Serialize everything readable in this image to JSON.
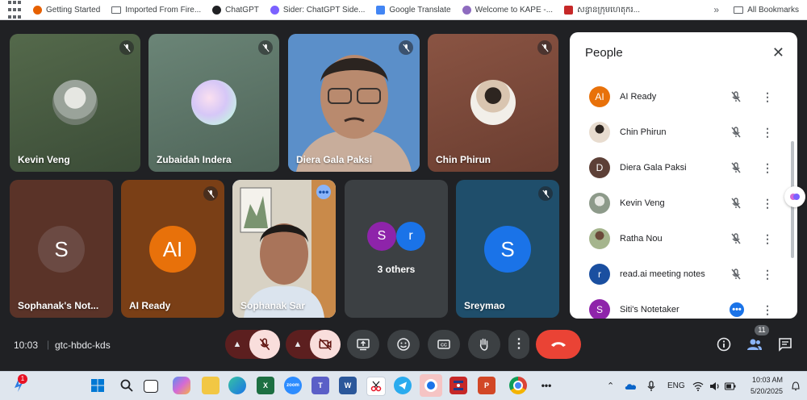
{
  "bookmarks": {
    "items": [
      {
        "label": "Getting Started",
        "icon": "firefox-icon",
        "color": "#e66000"
      },
      {
        "label": "Imported From Fire...",
        "icon": "folder-icon"
      },
      {
        "label": "ChatGPT",
        "icon": "chatgpt-icon",
        "color": "#202124"
      },
      {
        "label": "Sider: ChatGPT Side...",
        "icon": "sider-icon",
        "color": "#7b61ff"
      },
      {
        "label": "Google Translate",
        "icon": "translate-icon",
        "color": "#4285f4"
      },
      {
        "label": "Welcome to KAPE -...",
        "icon": "kape-icon",
        "color": "#8e6bbf"
      },
      {
        "label": "សន្ធានក្រុមហេតុករ...",
        "icon": "khmer-site-icon",
        "color": "#c62828"
      }
    ],
    "all_bookmarks": "All Bookmarks"
  },
  "tiles": [
    {
      "name": "Kevin Veng",
      "bg": "#4b6043",
      "muted": true
    },
    {
      "name": "Zubaidah Indera",
      "bg": "#5c7366",
      "muted": true
    },
    {
      "name": "Diera Gala Paksi",
      "bg": "#5b8fc9",
      "muted": true
    },
    {
      "name": "Chin Phirun",
      "bg": "#7a4a3a",
      "muted": true
    },
    {
      "name": "Sophanak's Not...",
      "bg": "#5a3328",
      "initial": "S",
      "avatar_color": "#6b4a43",
      "muted": false
    },
    {
      "name": "AI Ready",
      "bg": "#7a3f16",
      "initial": "AI",
      "avatar_color": "#e8710a",
      "muted": true
    },
    {
      "name": "Sophanak Sar",
      "bg": "#b9b2a0",
      "muted": false,
      "more": "•••"
    },
    {
      "name": "3 others",
      "bg": "#3c4043",
      "avatars": [
        {
          "initial": "S",
          "color": "#8e24aa"
        },
        {
          "initial": "r",
          "color": "#1a73e8"
        }
      ]
    },
    {
      "name": "Sreymao",
      "bg": "#1f4e6b",
      "initial": "S",
      "avatar_color": "#1a73e8",
      "muted": true
    }
  ],
  "panel": {
    "title": "People",
    "people": [
      {
        "name": "AI Ready",
        "initial": "AI",
        "color": "#e8710a",
        "muted": true
      },
      {
        "name": "Chin Phirun",
        "photo": true,
        "color": "#c9b8a6",
        "muted": true
      },
      {
        "name": "Diera Gala Paksi",
        "initial": "D",
        "color": "#5d4037",
        "muted": true
      },
      {
        "name": "Kevin Veng",
        "photo": true,
        "color": "#8d9a8a",
        "muted": true
      },
      {
        "name": "Ratha Nou",
        "photo": true,
        "color": "#a5b58d",
        "muted": true
      },
      {
        "name": "read.ai meeting notes",
        "initial": "r",
        "color": "#1a4fa0",
        "muted": true
      },
      {
        "name": "Siti's Notetaker",
        "initial": "S",
        "color": "#8e24aa",
        "speaking": true
      }
    ]
  },
  "toolbar": {
    "time": "10:03",
    "separator": "|",
    "meeting_code": "gtc-hbdc-kds",
    "people_count": "11"
  },
  "taskbar": {
    "notification_count": "1",
    "language": "ENG",
    "time": "10:03 AM",
    "date": "5/20/2025",
    "overflow": "•••"
  }
}
